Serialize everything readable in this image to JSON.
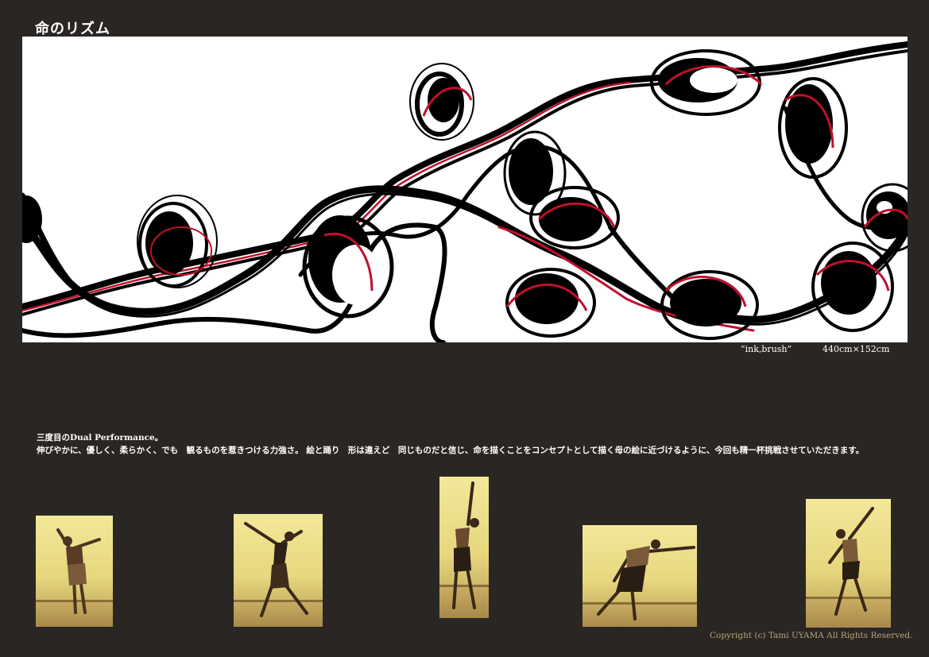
{
  "title": "命のリズム",
  "artwork": {
    "medium": "“ink,brush”",
    "size": "440cm×152cm"
  },
  "description": {
    "line1": "三度目のDual Performance。",
    "line2": "伸びやかに、優しく、柔らかく、でも　観るものを惹きつける力強さ。 絵と踊り　形は違えど　同じものだと信じ、命を描くことをコンセプトとして描く母の絵に近づけるように、今回も精一杯挑戦させていただきます。"
  },
  "copyright": "Copyright  (c)  Tami UYAMA  All Rights Reserved.",
  "colors": {
    "background": "#2a2623",
    "ink": "#000000",
    "accent_red": "#c0102a",
    "photo_tone": "#e7d77e"
  }
}
